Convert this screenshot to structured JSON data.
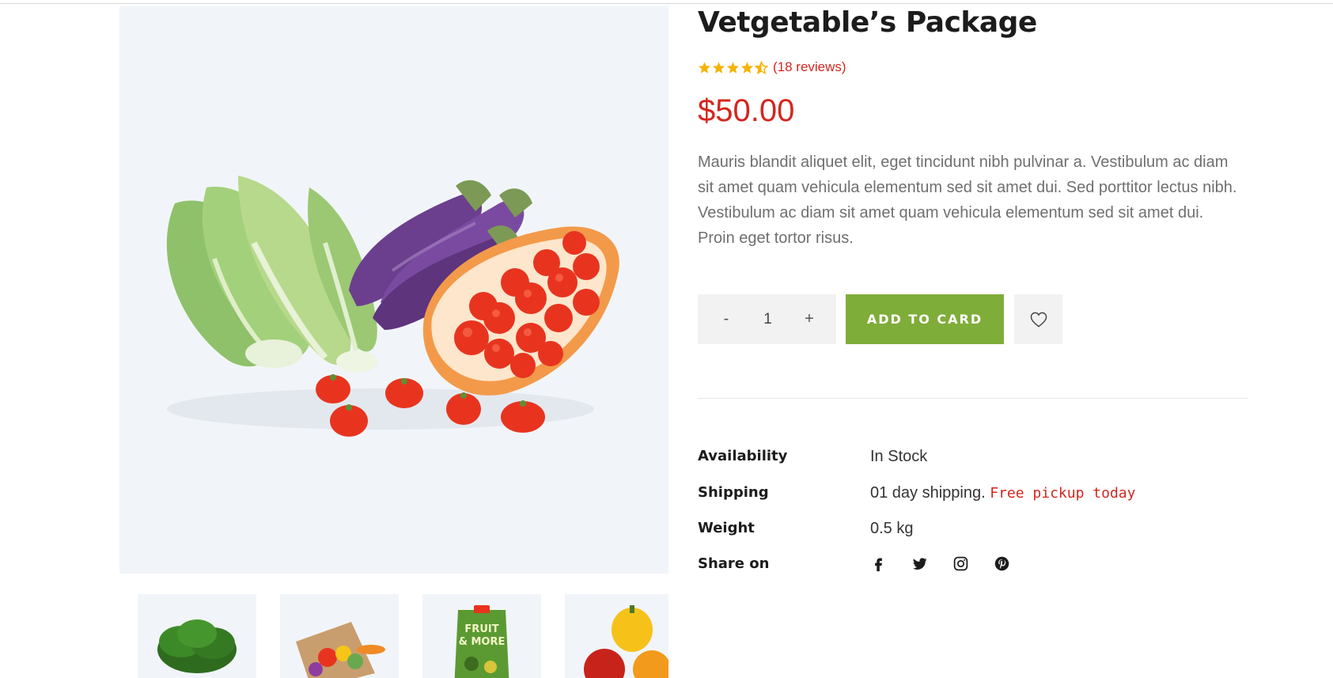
{
  "product": {
    "title": "Vetgetable’s Package",
    "reviews": "(18 reviews)",
    "rating": 4.5,
    "rating_max": 5,
    "price": "$50.00",
    "description": "Mauris blandit aliquet elit, eget tincidunt nibh pulvinar a. Vestibulum ac diam sit amet quam vehicula elementum sed sit amet dui. Sed porttitor lectus nibh. Vestibulum ac diam sit amet quam vehicula elementum sed sit amet dui. Proin eget tortor risus."
  },
  "cart": {
    "minus_label": "-",
    "quantity": "1",
    "plus_label": "+",
    "add_label": "ADD TO CARD",
    "wishlist_icon": "heart-icon"
  },
  "info": {
    "availability_label": "Availability",
    "availability_value": "In Stock",
    "shipping_label": "Shipping",
    "shipping_value": "01 day shipping.",
    "shipping_extra": "Free pickup today",
    "weight_label": "Weight",
    "weight_value": "0.5 kg",
    "share_label": "Share on"
  },
  "social": [
    "facebook-icon",
    "twitter-icon",
    "instagram-icon",
    "pinterest-icon"
  ],
  "gallery": {
    "main_image": "vegetables-package-image",
    "thumbnails": [
      "spinach-thumbnail",
      "grocery-bag-thumbnail",
      "fruit-and-more-thumbnail",
      "bell-peppers-thumbnail"
    ],
    "thumb_label_line1": "FRUIT",
    "thumb_label_line2": "& MORE"
  },
  "colors": {
    "accent_red": "#d4261f",
    "button_green": "#7fad39",
    "star_gold": "#f5b301",
    "image_background": "#f1f5f9"
  }
}
